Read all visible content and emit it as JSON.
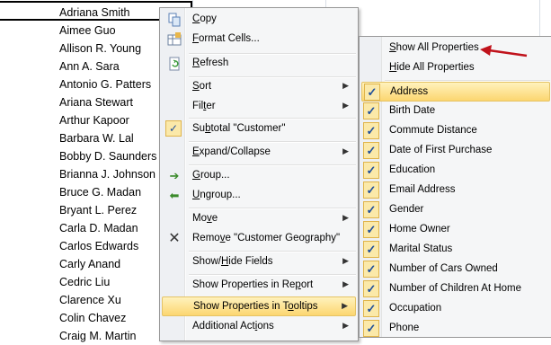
{
  "colors": {
    "accent_highlight": "#fcd670",
    "check": "#1f4f9b",
    "arrow": "#c0121b"
  },
  "sheet": {
    "names": [
      "Adriana Smith",
      "Aimee Guo",
      "Allison R. Young",
      "Ann A. Sara",
      "Antonio G. Patters",
      "Ariana Stewart",
      "Arthur Kapoor",
      "Barbara W. Lal",
      "Bobby D. Saunders",
      "Brianna J. Johnson",
      "Bruce G. Madan",
      "Bryant L. Perez",
      "Carla D. Madan",
      "Carlos Edwards",
      "Carly Anand",
      "Cedric Liu",
      "Clarence Xu",
      "Colin Chavez",
      "Craig M. Martin"
    ]
  },
  "context_menu": {
    "items": [
      {
        "label_pre": "",
        "label_u": "C",
        "label_post": "opy",
        "icon": "copy-icon"
      },
      {
        "label_pre": "",
        "label_u": "F",
        "label_post": "ormat Cells...",
        "icon": "format-cells-icon"
      },
      {
        "label_pre": "",
        "label_u": "R",
        "label_post": "efresh",
        "icon": "refresh-icon"
      },
      {
        "label_pre": "",
        "label_u": "S",
        "label_post": "ort",
        "icon": ""
      },
      {
        "label_pre": "Fil",
        "label_u": "t",
        "label_post": "er",
        "icon": ""
      },
      {
        "label_pre": "Su",
        "label_u": "b",
        "label_post": "total \"Customer\"",
        "icon": "checkmark-icon"
      },
      {
        "label_pre": "",
        "label_u": "E",
        "label_post": "xpand/Collapse",
        "icon": ""
      },
      {
        "label_pre": "",
        "label_u": "G",
        "label_post": "roup...",
        "icon": "group-icon"
      },
      {
        "label_pre": "",
        "label_u": "U",
        "label_post": "ngroup...",
        "icon": "ungroup-icon"
      },
      {
        "label_pre": "Mo",
        "label_u": "v",
        "label_post": "e",
        "icon": ""
      },
      {
        "label_pre": "Remo",
        "label_u": "v",
        "label_post": "e \"Customer Geography\"",
        "icon": "remove-icon"
      },
      {
        "label_pre": "Show/",
        "label_u": "H",
        "label_post": "ide Fields",
        "icon": ""
      },
      {
        "label_pre": "Show Properties in Re",
        "label_u": "p",
        "label_post": "ort",
        "icon": ""
      },
      {
        "label_pre": "Show Properties in T",
        "label_u": "o",
        "label_post": "oltips",
        "icon": ""
      },
      {
        "label_pre": "Additional Act",
        "label_u": "i",
        "label_post": "ons",
        "icon": ""
      }
    ]
  },
  "submenu": {
    "show_all_pre": "",
    "show_all_u": "S",
    "show_all_post": "how All Properties",
    "hide_all_pre": "",
    "hide_all_u": "H",
    "hide_all_post": "ide All Properties",
    "properties": [
      "Address",
      "Birth Date",
      "Commute Distance",
      "Date of First Purchase",
      "Education",
      "Email Address",
      "Gender",
      "Home Owner",
      "Marital Status",
      "Number of Cars Owned",
      "Number of Children At Home",
      "Occupation",
      "Phone"
    ],
    "check_glyph": "✓"
  }
}
